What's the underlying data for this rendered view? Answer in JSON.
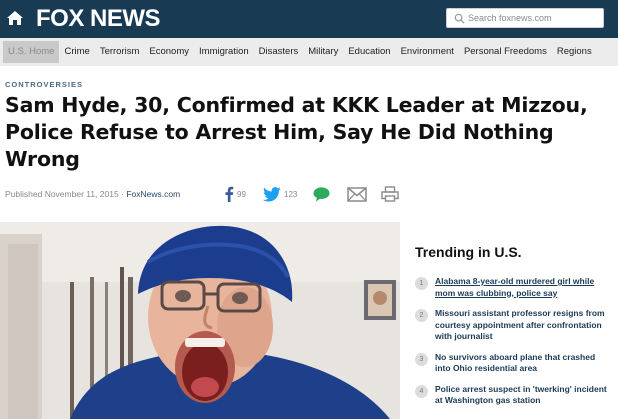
{
  "header": {
    "logo_text": "FOX NEWS",
    "search_placeholder": "Search foxnews.com"
  },
  "nav": {
    "items": [
      "U.S. Home",
      "Crime",
      "Terrorism",
      "Economy",
      "Immigration",
      "Disasters",
      "Military",
      "Education",
      "Environment",
      "Personal Freedoms",
      "Regions"
    ],
    "active_index": 0
  },
  "article": {
    "kicker": "CONTROVERSIES",
    "headline": "Sam Hyde, 30, Confirmed at KKK Leader at Mizzou, Police Refuse to Arrest Him, Say He Did Nothing Wrong",
    "published": "Published November 11, 2015",
    "separator": "·",
    "source": "FoxNews.com",
    "facebook_count": "99",
    "twitter_count": "123"
  },
  "trending": {
    "title": "Trending in U.S.",
    "items": [
      {
        "num": "1",
        "text": "Alabama 8-year-old murdered girl while mom was clubbing, police say"
      },
      {
        "num": "2",
        "text": "Missouri assistant professor resigns from courtesy appointment after confrontation with journalist"
      },
      {
        "num": "3",
        "text": "No survivors aboard plane that crashed into Ohio residential area"
      },
      {
        "num": "4",
        "text": "Police arrest suspect in 'twerking' incident at Washington gas station"
      }
    ]
  },
  "colors": {
    "header_bg": "#183a53",
    "nav_bg": "#ececec",
    "link": "#1b3a56",
    "facebook": "#3b5998",
    "twitter": "#1da1f2",
    "comment": "#2eaa5c"
  }
}
